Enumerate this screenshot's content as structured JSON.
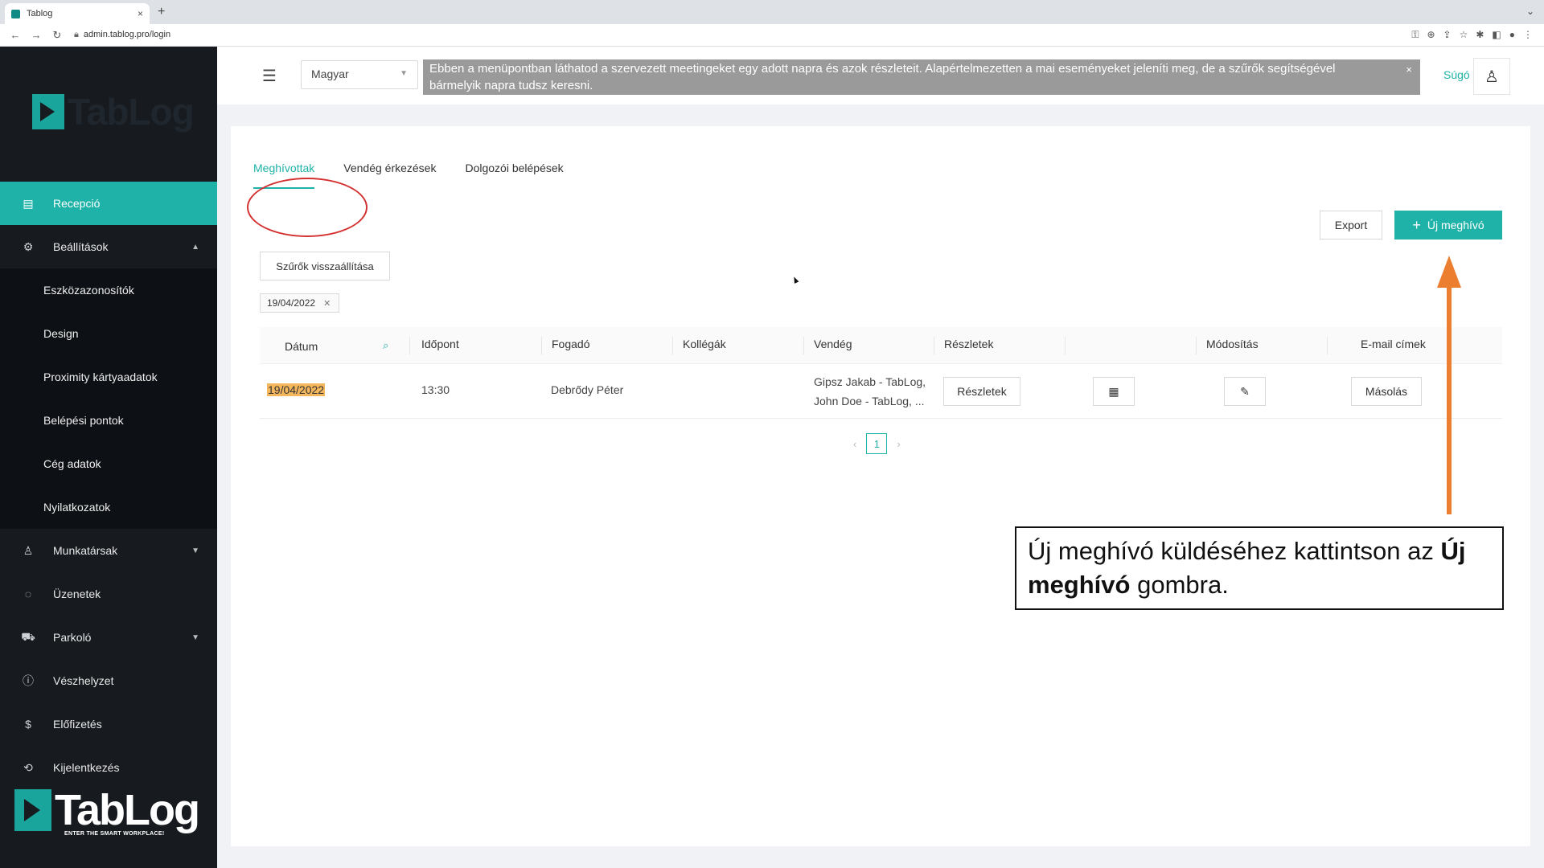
{
  "browser": {
    "tab_title": "Tablog",
    "tab_close": "×",
    "new_tab": "+",
    "url": "admin.tablog.pro/login"
  },
  "sidebar": {
    "brand_faint": "TabLog",
    "items": [
      {
        "label": "Recepció",
        "icon": "reception-icon",
        "active": true
      },
      {
        "label": "Beállítások",
        "icon": "gear-icon",
        "expanded": true
      }
    ],
    "submenu": [
      "Eszközazonosítók",
      "Design",
      "Proximity kártyaadatok",
      "Belépési pontok",
      "Cég adatok",
      "Nyilatkozatok"
    ],
    "items_after": [
      {
        "label": "Munkatársak",
        "icon": "user-icon",
        "has_chevron": true
      },
      {
        "label": "Üzenetek",
        "icon": "message-icon"
      },
      {
        "label": "Parkoló",
        "icon": "car-icon",
        "has_chevron": true
      },
      {
        "label": "Vészhelyzet",
        "icon": "alert-icon"
      },
      {
        "label": "Előfizetés",
        "icon": "dollar-icon"
      },
      {
        "label": "Kijelentkezés",
        "icon": "logout-icon"
      }
    ],
    "logo_text": "TabLog",
    "logo_tagline": "ENTER THE SMART WORKPLACE!"
  },
  "header": {
    "language": "Magyar",
    "info_text": "Ebben a menüpontban láthatod a szervezett meetingeket egy adott napra és azok részleteit. Alapértelmezetten a mai eseményeket jeleníti meg, de a szűrők segítségével bármelyik napra tudsz keresni.",
    "info_close": "×",
    "help": "Súgó"
  },
  "tabs": [
    "Meghívottak",
    "Vendég érkezések",
    "Dolgozói belépések"
  ],
  "actions": {
    "export": "Export",
    "new_invite": "Új meghívó",
    "reset_filters": "Szűrők visszaállítása"
  },
  "filter_tag": "19/04/2022",
  "table": {
    "headers": [
      "Dátum",
      "Időpont",
      "Fogadó",
      "Kollégák",
      "Vendég",
      "Részletek",
      "",
      "Módosítás",
      "E-mail címek"
    ],
    "rows": [
      {
        "date": "19/04/2022",
        "time": "13:30",
        "host": "Debrődy Péter",
        "colleagues": "",
        "guest_line1": "Gipsz Jakab - TabLog,",
        "guest_line2": "John Doe - TabLog, ...",
        "details_btn": "Részletek",
        "copy_btn": "Másolás"
      }
    ]
  },
  "pagination": {
    "current": "1",
    "prev": "‹",
    "next": "›"
  },
  "annotation": {
    "text_before": "Új meghívó küldéséhez kattintson az ",
    "bold1": "Új",
    "bold2": "meghívó",
    "text_after": " gombra.",
    "accent_color": "#ec7e2f",
    "circle_color": "#d3302f"
  },
  "colors": {
    "primary": "#1fb2a8",
    "sidebar_bg": "#171b20",
    "date_highlight": "#f5b75d"
  }
}
